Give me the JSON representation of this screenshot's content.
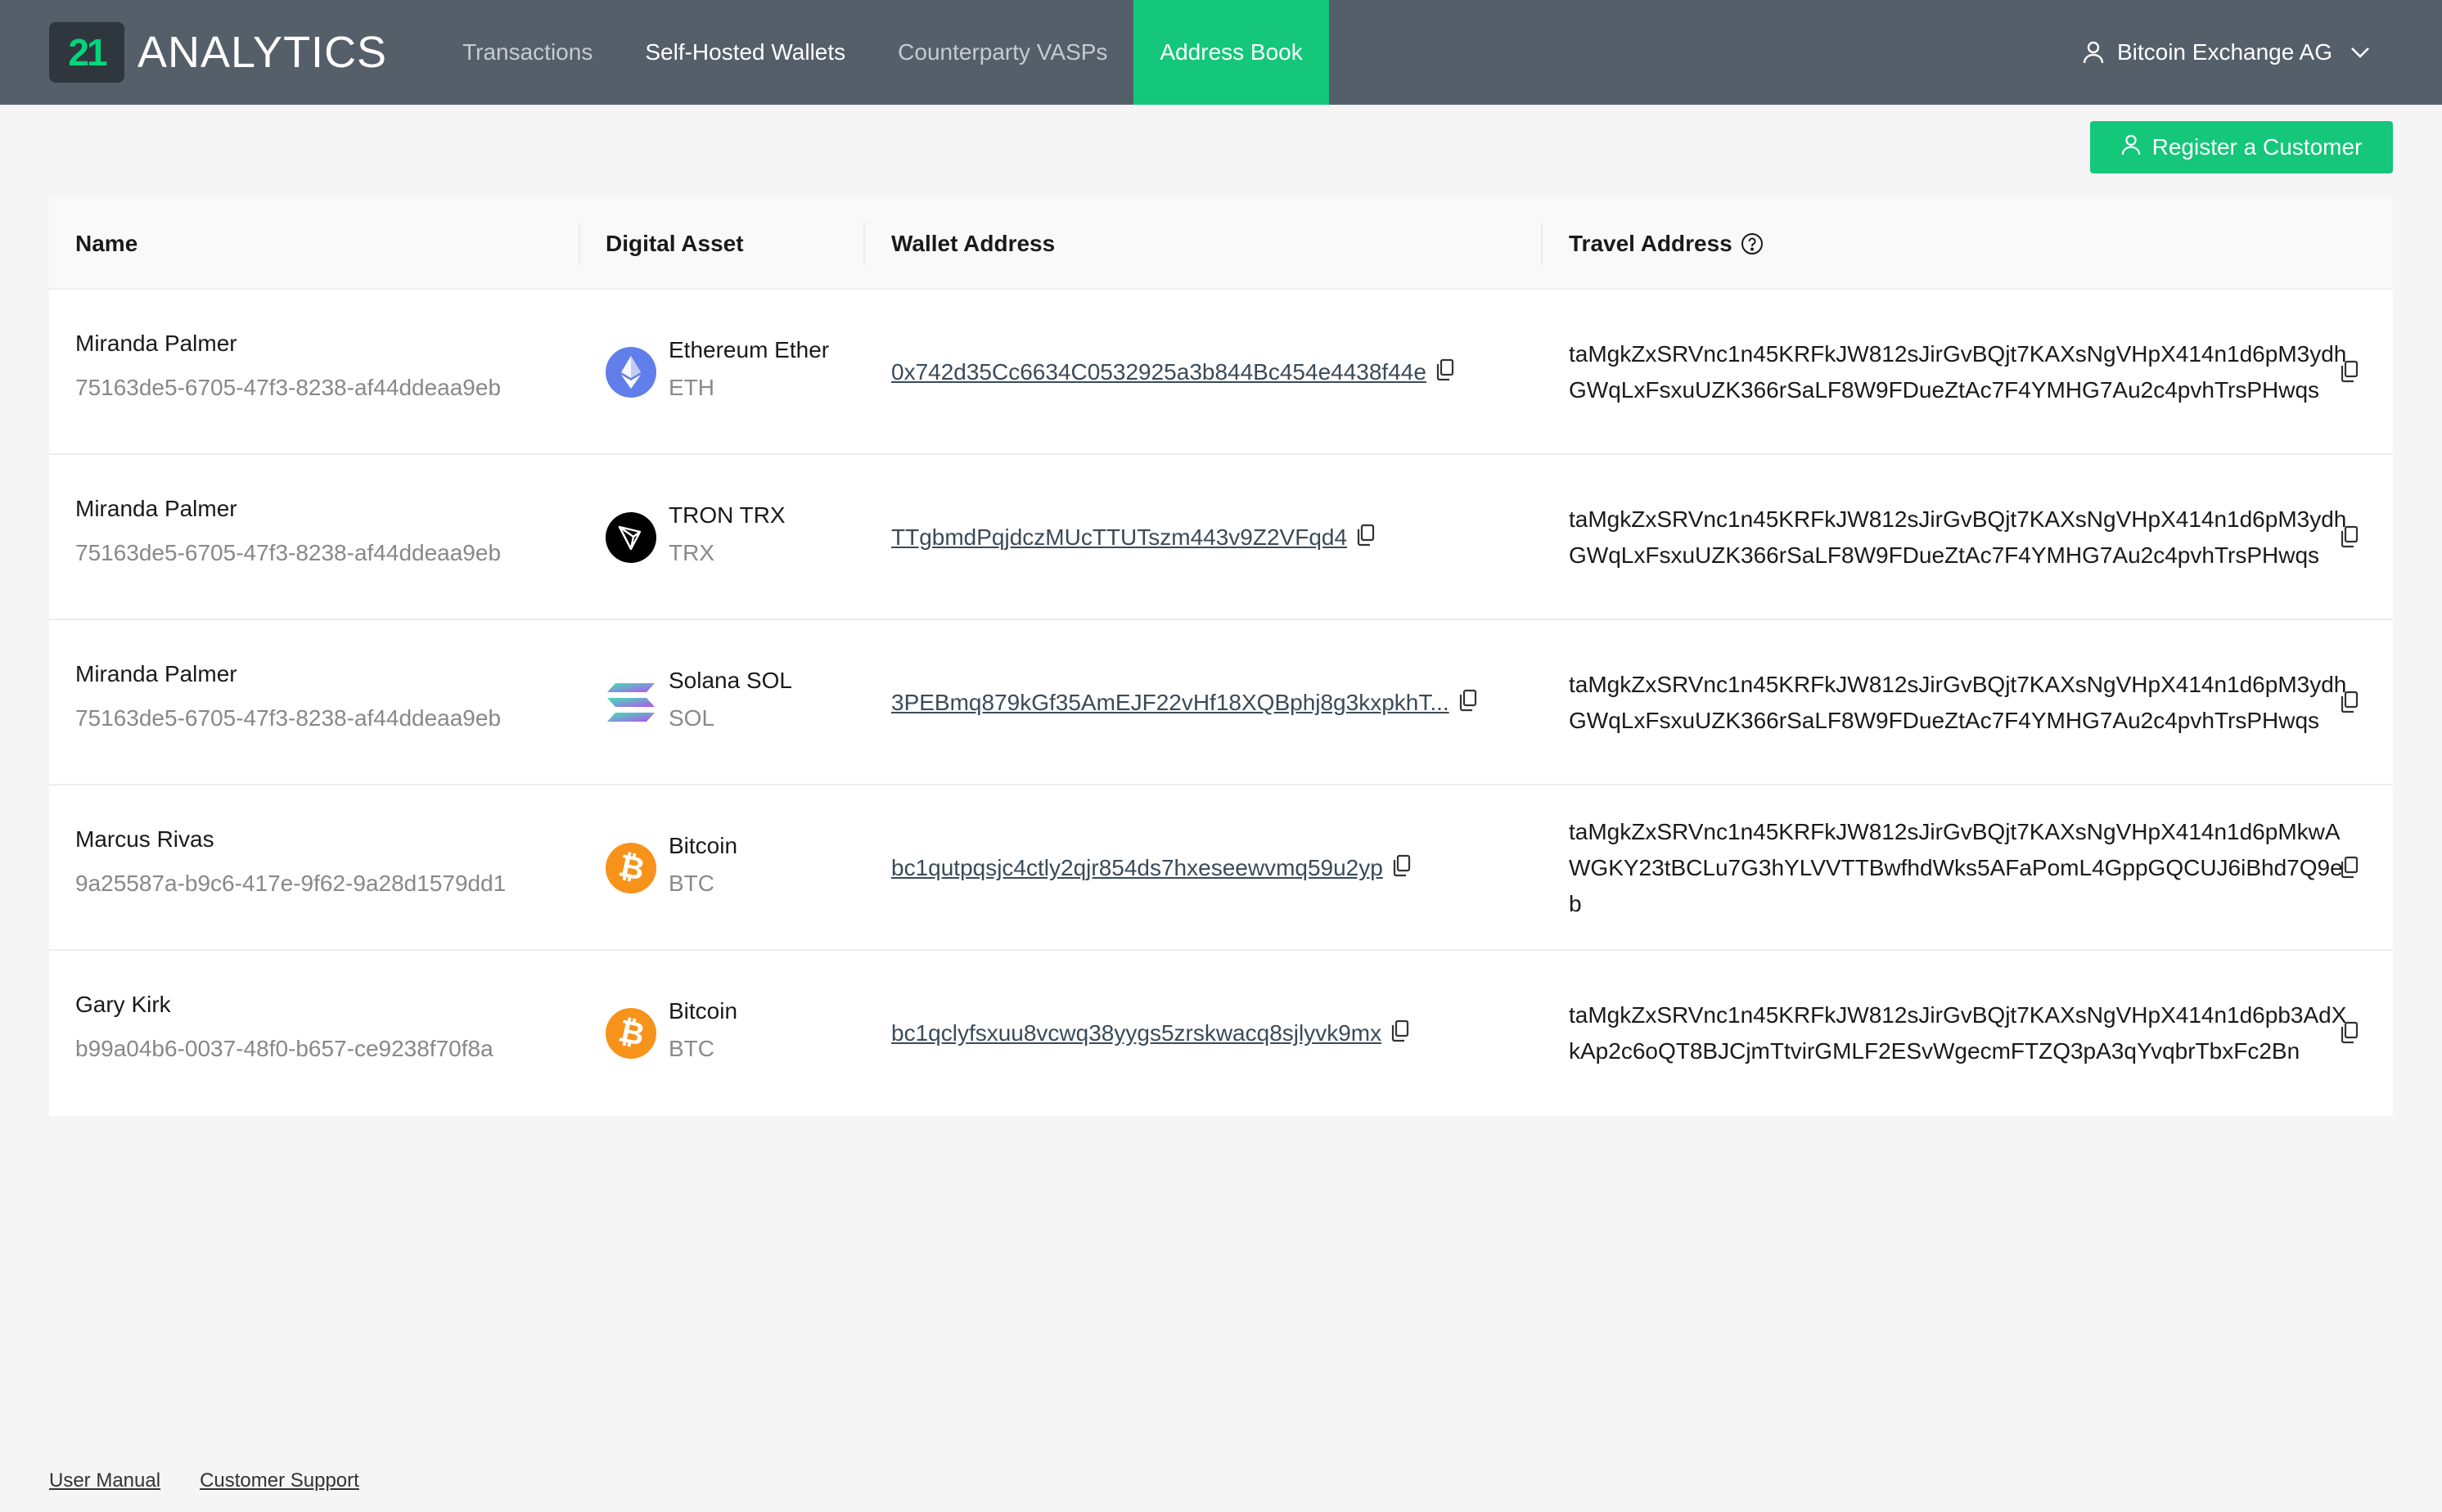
{
  "app": {
    "logo_number": "21",
    "logo_text": "ANALYTICS",
    "accent_color": "#14c77a",
    "header_color": "#555f69"
  },
  "nav": {
    "items": [
      {
        "label": "Transactions"
      },
      {
        "label": "Self-Hosted Wallets"
      },
      {
        "label": "Counterparty VASPs"
      },
      {
        "label": "Address Book"
      }
    ],
    "active": "Address Book"
  },
  "account": {
    "label": "Bitcoin Exchange AG",
    "icon": "user-icon"
  },
  "actions": {
    "register_label": "Register a Customer"
  },
  "table": {
    "headers": {
      "name": "Name",
      "asset": "Digital Asset",
      "wallet": "Wallet Address",
      "travel": "Travel Address"
    },
    "rows": [
      {
        "name": "Miranda Palmer",
        "id": "75163de5-6705-47f3-8238-af44ddeaa9eb",
        "asset_name": "Ethereum Ether",
        "asset_symbol": "ETH",
        "asset_icon": "ethereum-icon",
        "wallet": "0x742d35Cc6634C0532925a3b844Bc454e4438f44e",
        "travel": "taMgkZxSRVnc1n45KRFkJW812sJirGvBQjt7KAXsNgVHpX414n1d6pM3ydhGWqLxFsxuUZK366rSaLF8W9FDueZtAc7F4YMHG7Au2c4pvhTrsPHwqs"
      },
      {
        "name": "Miranda Palmer",
        "id": "75163de5-6705-47f3-8238-af44ddeaa9eb",
        "asset_name": "TRON TRX",
        "asset_symbol": "TRX",
        "asset_icon": "tron-icon",
        "wallet": "TTgbmdPqjdczMUcTTUTszm443v9Z2VFqd4",
        "travel": "taMgkZxSRVnc1n45KRFkJW812sJirGvBQjt7KAXsNgVHpX414n1d6pM3ydhGWqLxFsxuUZK366rSaLF8W9FDueZtAc7F4YMHG7Au2c4pvhTrsPHwqs"
      },
      {
        "name": "Miranda Palmer",
        "id": "75163de5-6705-47f3-8238-af44ddeaa9eb",
        "asset_name": "Solana SOL",
        "asset_symbol": "SOL",
        "asset_icon": "solana-icon",
        "wallet": "3PEBmq879kGf35AmEJF22vHf18XQBphj8g3kxpkhT...",
        "travel": "taMgkZxSRVnc1n45KRFkJW812sJirGvBQjt7KAXsNgVHpX414n1d6pM3ydhGWqLxFsxuUZK366rSaLF8W9FDueZtAc7F4YMHG7Au2c4pvhTrsPHwqs"
      },
      {
        "name": "Marcus Rivas",
        "id": "9a25587a-b9c6-417e-9f62-9a28d1579dd1",
        "asset_name": "Bitcoin",
        "asset_symbol": "BTC",
        "asset_icon": "bitcoin-icon",
        "wallet": "bc1qutpqsjc4ctly2qjr854ds7hxeseewvmq59u2yp",
        "travel": "taMgkZxSRVnc1n45KRFkJW812sJirGvBQjt7KAXsNgVHpX414n1d6pMkwAWGKY23tBCLu7G3hYLVVTTBwfhdWks5AFaPomL4GppGQCUJ6iBhd7Q9eb"
      },
      {
        "name": "Gary Kirk",
        "id": "b99a04b6-0037-48f0-b657-ce9238f70f8a",
        "asset_name": "Bitcoin",
        "asset_symbol": "BTC",
        "asset_icon": "bitcoin-icon",
        "wallet": "bc1qclyfsxuu8vcwq38yygs5zrskwacq8sjlyvk9mx",
        "travel": "taMgkZxSRVnc1n45KRFkJW812sJirGvBQjt7KAXsNgVHpX414n1d6pb3AdXkAp2c6oQT8BJCjmTtvirGMLF2ESvWgecmFTZQ3pA3qYvqbrTbxFc2Bn"
      }
    ]
  },
  "footer": {
    "manual": "User Manual",
    "support": "Customer Support"
  }
}
